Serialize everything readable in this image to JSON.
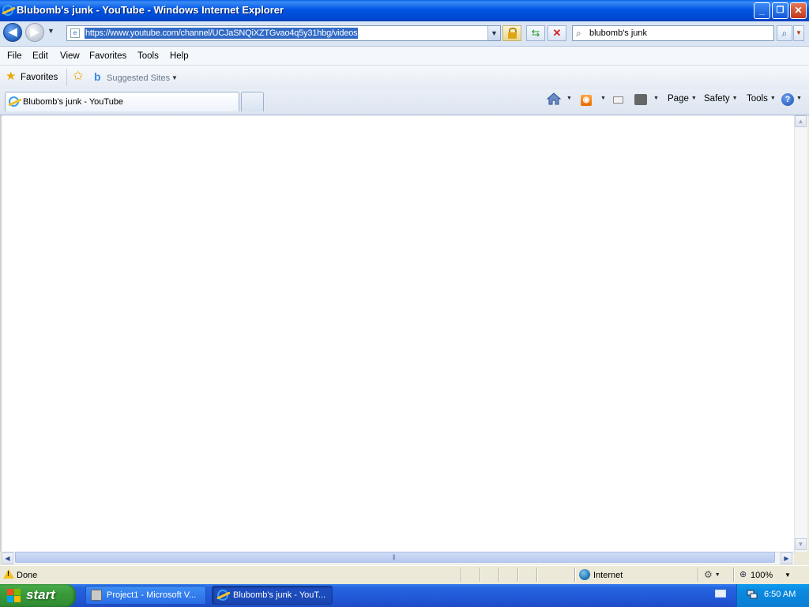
{
  "window": {
    "title": "Blubomb's junk - YouTube - Windows Internet Explorer",
    "minimize_glyph": "_",
    "maximize_glyph": "❐",
    "close_glyph": "✕"
  },
  "address": {
    "url": "https://www.youtube.com/channel/UCJaSNQiXZTGvao4q5y31hbg/videos",
    "search_value": "blubomb's junk"
  },
  "menu": {
    "items": [
      "File",
      "Edit",
      "View",
      "Favorites",
      "Tools",
      "Help"
    ]
  },
  "favorites_bar": {
    "favorites_label": "Favorites",
    "suggested_label": "Suggested Sites"
  },
  "tabs": [
    {
      "title": "Blubomb's junk - YouTube",
      "active": true
    }
  ],
  "command_bar": {
    "page_label": "Page",
    "safety_label": "Safety",
    "tools_label": "Tools",
    "help_glyph": "?"
  },
  "status": {
    "text": "Done",
    "zone": "Internet",
    "zoom": "100%"
  },
  "taskbar": {
    "start_label": "start",
    "buttons": [
      {
        "label": "Project1 - Microsoft V...",
        "active": false
      },
      {
        "label": "Blubomb's junk - YouT...",
        "active": true
      }
    ],
    "clock": "6:50 AM"
  },
  "icons": {
    "back": "back-arrow-icon",
    "forward": "forward-arrow-icon",
    "lock": "lock-icon",
    "refresh": "refresh-icon",
    "stop": "stop-icon",
    "search": "search-icon",
    "home": "home-icon",
    "feeds": "rss-icon",
    "mail": "mail-icon",
    "print": "print-icon"
  },
  "colors": {
    "titlebar": "#0054e3",
    "taskbar": "#2258d8",
    "start_button": "#3a9b3a",
    "url_selection": "#316ac5"
  }
}
